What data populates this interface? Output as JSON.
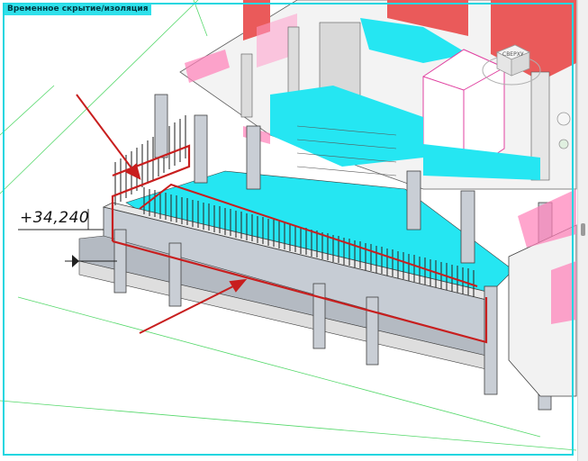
{
  "viewport": {
    "mode_label": "Временное скрытие/изоляция",
    "frame_color": "#1fd6e0"
  },
  "annotation": {
    "elevation_label": "+34,240",
    "arrow_color": "#c81e1e",
    "highlight_color": "#c81e1e"
  },
  "view_cube": {
    "face_label": "СВЕРХУ"
  },
  "colors": {
    "glass": "#25e6f2",
    "concrete": "#c6ccd4",
    "pink": "#ff7fb8",
    "red_wall": "#ea5a5a"
  }
}
